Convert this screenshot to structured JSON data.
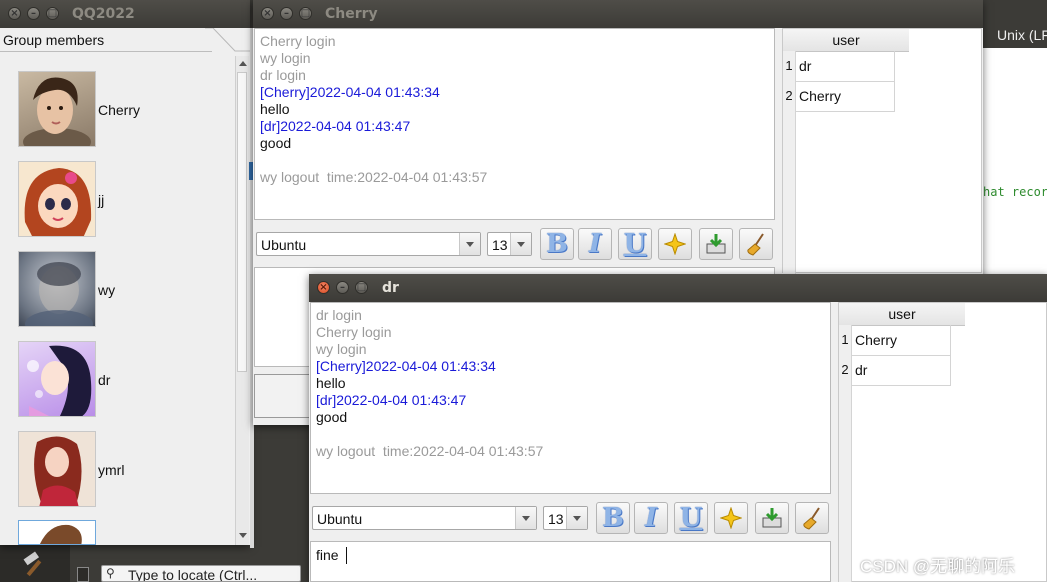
{
  "qq_window": {
    "title": "QQ2022",
    "tab_label": "Group members",
    "members": [
      {
        "name": "Cherry",
        "avatar": "warrior-avatar-icon"
      },
      {
        "name": "jj",
        "avatar": "cartoon-girl-avatar-icon"
      },
      {
        "name": "wy",
        "avatar": "blurred-avatar-icon"
      },
      {
        "name": "dr",
        "avatar": "anime-girl-avatar-icon"
      },
      {
        "name": "ymrl",
        "avatar": "redhead-avatar-icon"
      }
    ]
  },
  "cherry_window": {
    "title": "Cherry",
    "log": [
      {
        "text": "Cherry login",
        "style": "gray"
      },
      {
        "text": "wy login",
        "style": "gray"
      },
      {
        "text": "dr login",
        "style": "gray"
      },
      {
        "text": "[Cherry]2022-04-04 01:43:34",
        "style": "blue"
      },
      {
        "text": "hello",
        "style": "black"
      },
      {
        "text": "[dr]2022-04-04 01:43:47",
        "style": "blue"
      },
      {
        "text": "good",
        "style": "black"
      },
      {
        "text": "",
        "style": "black"
      },
      {
        "text": "wy logout  time:2022-04-04 01:43:57",
        "style": "gray"
      }
    ],
    "font_family": "Ubuntu",
    "font_size": "13",
    "users_header": "user",
    "users": [
      {
        "num": "1",
        "name": "dr"
      },
      {
        "num": "2",
        "name": "Cherry"
      }
    ]
  },
  "dr_window": {
    "title": "dr",
    "log": [
      {
        "text": "dr login",
        "style": "gray"
      },
      {
        "text": "Cherry login",
        "style": "gray"
      },
      {
        "text": "wy login",
        "style": "gray"
      },
      {
        "text": "[Cherry]2022-04-04 01:43:34",
        "style": "blue"
      },
      {
        "text": "hello",
        "style": "black"
      },
      {
        "text": "[dr]2022-04-04 01:43:47",
        "style": "blue"
      },
      {
        "text": "good",
        "style": "black"
      },
      {
        "text": "",
        "style": "black"
      },
      {
        "text": "wy logout  time:2022-04-04 01:43:57",
        "style": "gray"
      }
    ],
    "font_family": "Ubuntu",
    "font_size": "13",
    "users_header": "user",
    "users": [
      {
        "num": "1",
        "name": "Cherry"
      },
      {
        "num": "2",
        "name": "dr"
      }
    ],
    "input_text": "fine"
  },
  "background": {
    "unix_label": "Unix (LF",
    "chat_record_fragment": "hat recor",
    "locate_placeholder": "Type to locate (Ctrl...",
    "watermark": "CSDN @无聊的阿乐"
  },
  "toolbar_icons": [
    "bold-icon",
    "italic-icon",
    "underline-icon",
    "color-star-icon",
    "save-icon",
    "clear-broom-icon"
  ],
  "colors": {
    "system_text": "#9a9a9a",
    "user_header": "#1a1ad8",
    "titlebar": "#3c3b37"
  }
}
